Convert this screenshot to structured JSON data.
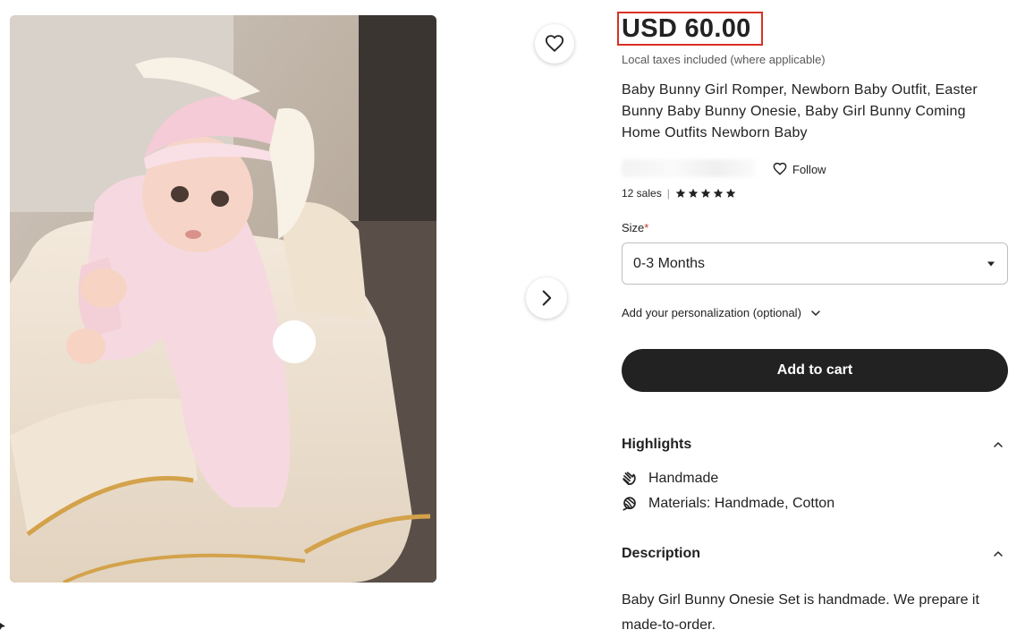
{
  "listing": {
    "price": "USD 60.00",
    "taxes_note": "Local taxes included (where applicable)",
    "title": "Baby Bunny Girl Romper, Newborn Baby Outfit, Easter Bunny Baby Bunny Onesie, Baby Girl Bunny Coming Home Outfits Newborn Baby",
    "follow_label": "Follow",
    "sales": "12 sales",
    "rating_stars": 5,
    "size_label": "Size",
    "size_required_mark": "*",
    "size_selected": "0-3 Months",
    "personalization_label": "Add your personalization (optional)",
    "add_to_cart_label": "Add to cart",
    "highlights_title": "Highlights",
    "highlights": [
      {
        "icon": "hand-icon",
        "text": "Handmade"
      },
      {
        "icon": "yarn-icon",
        "text": "Materials: Handmade, Cotton"
      }
    ],
    "description_title": "Description",
    "description_text": "Baby Girl Bunny Onesie Set is handmade. We prepare it made-to-order."
  },
  "colors": {
    "accent_dark": "#222222",
    "price_highlight_border": "#d93025",
    "required_star": "#c0392b"
  }
}
